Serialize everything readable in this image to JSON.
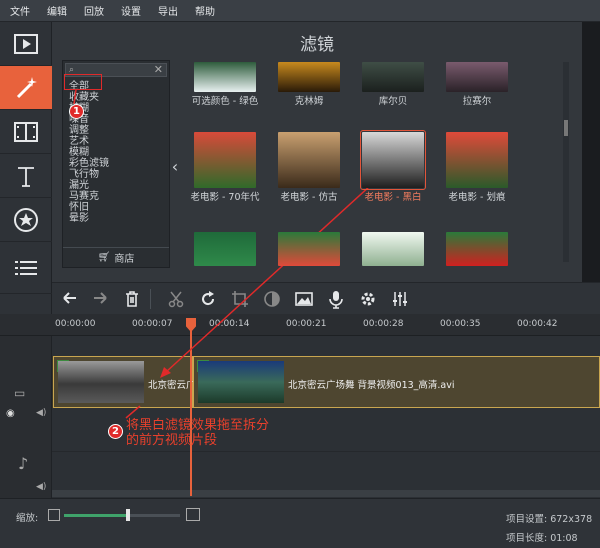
{
  "menu": [
    "文件",
    "编辑",
    "回放",
    "设置",
    "导出",
    "帮助"
  ],
  "left_tools": [
    {
      "icon": "film-import-icon",
      "active": false
    },
    {
      "icon": "magic-wand-icon",
      "active": true
    },
    {
      "icon": "film-transition-icon",
      "active": false
    },
    {
      "icon": "text-icon",
      "active": false
    },
    {
      "icon": "sticker-star-icon",
      "active": false
    },
    {
      "icon": "list-icon",
      "active": false
    }
  ],
  "panel": {
    "title": "滤镜",
    "categories": [
      "全部",
      "收藏夹",
      "模糊",
      "噪音",
      "调整",
      "艺术",
      "模糊",
      "彩色滤镜",
      "飞行物",
      "漏光",
      "马赛克",
      "怀旧",
      "晕影"
    ],
    "shop_label": "商店",
    "filters": [
      {
        "label": "可选颜色 - 绿色",
        "colors": [
          "#2e5c3c",
          "#e8f0f0"
        ]
      },
      {
        "label": "克林姆",
        "colors": [
          "#c88a1e",
          "#2a1a08"
        ]
      },
      {
        "label": "库尔贝",
        "colors": [
          "#3f4e46",
          "#1b201e"
        ]
      },
      {
        "label": "拉赛尔",
        "colors": [
          "#7a5b6e",
          "#2a2228"
        ]
      },
      {
        "label": "老电影 - 70年代",
        "colors": [
          "#d84a3a",
          "#2f6a2a"
        ]
      },
      {
        "label": "老电影 - 仿古",
        "colors": [
          "#c9a070",
          "#3a2a1a"
        ]
      },
      {
        "label": "老电影 - 黑白",
        "colors": [
          "#d8d8d8",
          "#1e1e1e"
        ],
        "selected": true
      },
      {
        "label": "老电影 - 划痕",
        "colors": [
          "#e04a3a",
          "#2a5a2a"
        ]
      },
      {
        "label": "",
        "colors": [
          "#1f6a3a",
          "#2f8a4a"
        ]
      },
      {
        "label": "",
        "colors": [
          "#2a7a3a",
          "#e04a3a"
        ]
      },
      {
        "label": "",
        "colors": [
          "#f0f8f0",
          "#8fb090"
        ]
      },
      {
        "label": "",
        "colors": [
          "#2a7a3a",
          "#d02020"
        ]
      }
    ]
  },
  "edit_tools": [
    "undo-icon",
    "redo-icon",
    "trash-icon",
    "scissors-icon",
    "rotate-icon",
    "crop-icon",
    "color-adjust-icon",
    "image-icon",
    "microphone-icon",
    "gear-icon",
    "equalizer-icon"
  ],
  "ruler": [
    "00:00:00",
    "00:00:07",
    "00:00:14",
    "00:00:21",
    "00:00:28",
    "00:00:35",
    "00:00:42"
  ],
  "clips": [
    {
      "label": "北京密云广"
    },
    {
      "label": "北京密云广场舞 背景视频013_高清.avi"
    }
  ],
  "annotations": {
    "step1": "1",
    "step2": "2",
    "instruction_line1": "将黑白滤镜效果拖至拆分",
    "instruction_line2": "的前方视频片段"
  },
  "status": {
    "zoom_label": "缩放:",
    "zoom_level": 0.55,
    "project_settings": "项目设置:  672x378",
    "project_length": "项目长度:  01:08"
  }
}
